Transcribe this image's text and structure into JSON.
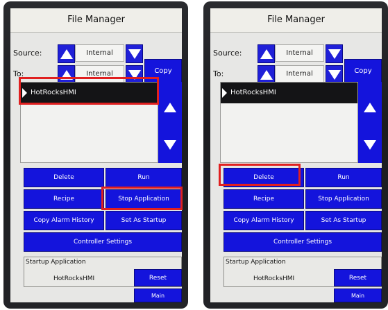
{
  "screens": [
    {
      "title": "File Manager",
      "source_label": "Source:",
      "source_value": "Internal",
      "to_label": "To:",
      "to_value": "Internal",
      "copy": "Copy",
      "list_items": [
        "HotRocksHMI"
      ],
      "delete": "Delete",
      "run": "Run",
      "recipe": "Recipe",
      "stop_application": "Stop Application",
      "copy_alarm_history": "Copy Alarm History",
      "set_as_startup": "Set As Startup",
      "controller_settings": "Controller Settings",
      "startup_label": "Startup Application",
      "startup_value": "HotRocksHMI",
      "reset": "Reset",
      "main": "Main",
      "highlighted": [
        "list_item",
        "stop_application"
      ]
    },
    {
      "title": "File Manager",
      "source_label": "Source:",
      "source_value": "Internal",
      "to_label": "To:",
      "to_value": "Internal",
      "copy": "Copy",
      "list_items": [
        "HotRocksHMI"
      ],
      "delete": "Delete",
      "run": "Run",
      "recipe": "Recipe",
      "stop_application": "Stop Application",
      "copy_alarm_history": "Copy Alarm History",
      "set_as_startup": "Set As Startup",
      "controller_settings": "Controller Settings",
      "startup_label": "Startup Application",
      "startup_value": "HotRocksHMI",
      "reset": "Reset",
      "main": "Main",
      "highlighted": [
        "delete"
      ]
    }
  ],
  "colors": {
    "button_blue": "#1414dc",
    "highlight_red": "#e02020",
    "screen_bg": "#e7e7e5",
    "bezel": "#1f2023"
  },
  "icons": [
    "up-arrow-icon",
    "down-arrow-icon",
    "list-marker-icon"
  ]
}
